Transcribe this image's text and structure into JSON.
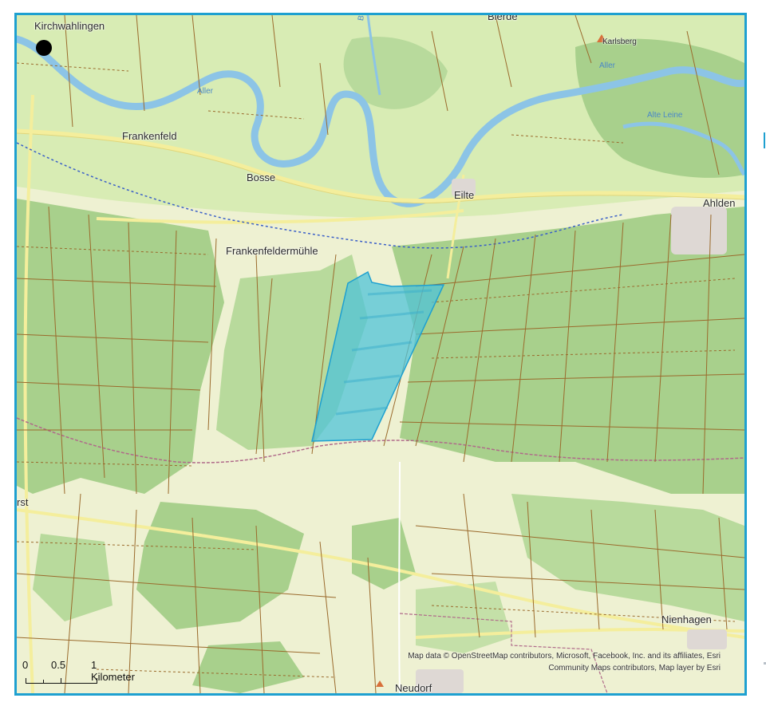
{
  "places": {
    "kirchwahlingen": "Kirchwahlingen",
    "frankenfeld": "Frankenfeld",
    "bosse": "Bosse",
    "eilte": "Eilte",
    "ahlden": "Ahlden",
    "frankenfeldermuehle": "Frankenfeldermühle",
    "nienhagen": "Nienhagen",
    "neudorf": "Neudorf",
    "karlsberg": "Karlsberg",
    "bierde": "Bierde",
    "edge_left": "rst"
  },
  "rivers": {
    "aller_1": "Aller",
    "aller_2": "Aller",
    "alte_leine": "Alte Leine",
    "bohme": "Bohme"
  },
  "scale_bar": {
    "zero": "0",
    "half": "0.5",
    "one": "1 Kilometer"
  },
  "attribution": "Map data © OpenStreetMap contributors, Microsoft, Facebook, Inc. and its affiliates, Esri Community Maps contributors, Map layer by Esri",
  "colors": {
    "frame": "#1ea0d0",
    "field": "#eef1d2",
    "forest": "#a8d08c",
    "forest_dark": "#95c47a",
    "meadow": "#d8ecb4",
    "river": "#8cc4e6",
    "road": "#f4ee9c",
    "track": "#9a6a2c",
    "boundary": "#3a5fc8",
    "polygon_fill": "#4fc3d8",
    "polygon_stroke": "#1ea0d0"
  }
}
